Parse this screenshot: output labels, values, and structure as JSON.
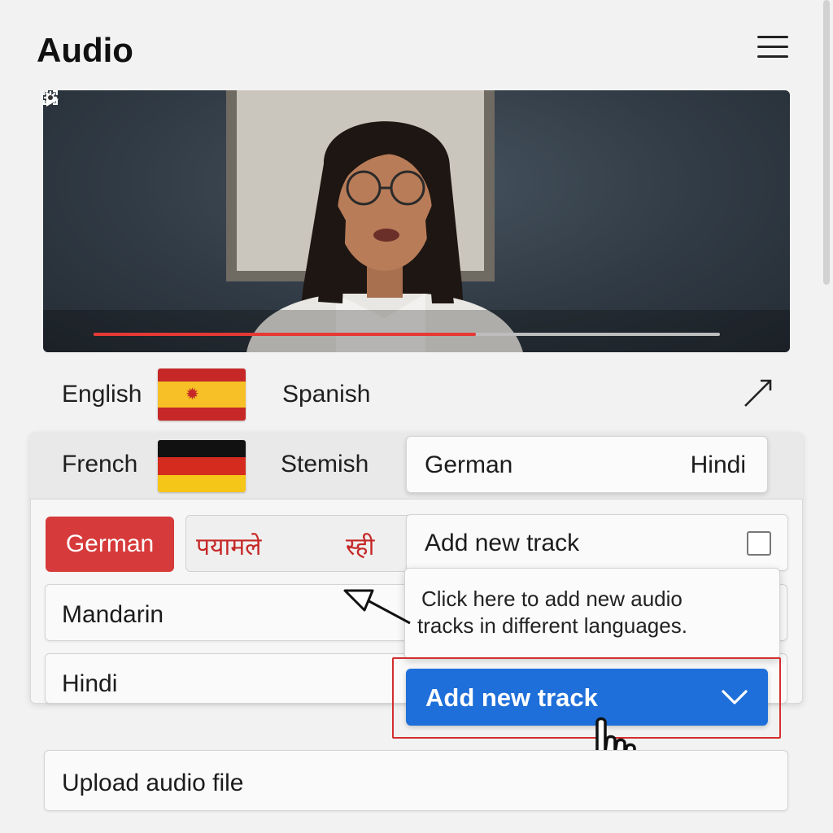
{
  "header": {
    "title": "Audio"
  },
  "video": {
    "progress_percent": 61,
    "colors": {
      "progress": "#e53935",
      "track": "#bdbdbd"
    }
  },
  "language_row": {
    "first": "English",
    "second": "Spanish"
  },
  "panel": {
    "header": {
      "first": "French",
      "second": "Stemish"
    },
    "german_hindi_card": {
      "left": "German",
      "right": "Hindi"
    },
    "selected_chip": "German",
    "script_box": {
      "left_text": "पयामले",
      "right_text": "स्ही"
    },
    "add_track_row": {
      "label": "Add new track",
      "checked": false
    },
    "rows": [
      "Mandarin",
      "Hindi"
    ]
  },
  "tooltip": {
    "line1": "Click here to add new audio",
    "line2": "tracks in different languages."
  },
  "primary_button": {
    "label": "Add new track",
    "color": "#1e6fd9"
  },
  "upload": {
    "label": "Upload audio file"
  },
  "colors": {
    "accent_red": "#d63a3a",
    "highlight": "#d32f2f"
  }
}
